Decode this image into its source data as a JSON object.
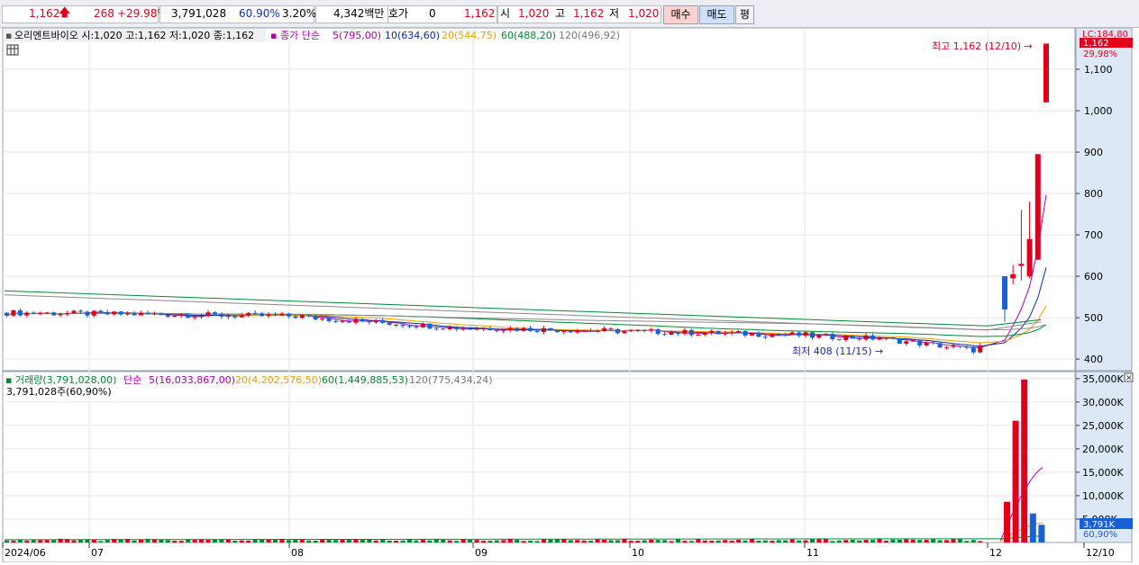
{
  "quote_bar": {
    "price": "1,162",
    "change_arrow": "up-arrow-icon",
    "change": "268",
    "change_pct": "+29.98%",
    "volume": "3,791,028",
    "volume_ratio": "60.90%",
    "turnover": "3.20%",
    "amount": "4,342백만",
    "hoga_label": "호가",
    "hoga_value": "0",
    "hoga_price": "1,162",
    "open_label": "시",
    "open_value": "1,020",
    "high_label": "고",
    "high_value": "1,162",
    "low_label": "저",
    "low_value": "1,020",
    "buy_label": "매수",
    "sell_label": "매도",
    "avg_label": "평"
  },
  "price_panel": {
    "stock_info": "오리엔트바이오 시:1,020 고:1,162 저:1,020 종:1,162",
    "ma_label": "종가 단순",
    "ma5": "5(795,00)",
    "ma10": "10(634,60)",
    "ma20": "20(544,75)",
    "ma60": "60(488,20)",
    "ma120": "120(496,92)",
    "lc_label": "LC:184,80",
    "price_tag": "1,162",
    "pct_tag": "29,98%",
    "high_note": "최고 1,162 (12/10) →",
    "low_note": "최저 408 (11/15) →"
  },
  "volume_panel": {
    "label": "거래량(3,791,028,00)",
    "ma_label": "단순",
    "ma5": "5(16,033,867,00)",
    "ma20": "20(4,202,576,50)",
    "ma60": "60(1,449,885,53)",
    "ma120": "120(775,434,24)",
    "current": "3,791,028주(60,90%)",
    "vol_tag": "3,791K",
    "pct_tag": "60,90%"
  },
  "colors": {
    "up": "#e0001c",
    "down": "#1760d6",
    "ma5": "#b000b0",
    "ma10": "#0a2a9c",
    "ma20": "#f0a000",
    "ma60": "#008a30",
    "ma120": "#8a8a8a",
    "axis_bg": "#dce8f5"
  },
  "chart_data": {
    "type": "candlestick",
    "x_labels": [
      "2024/06",
      "07",
      "08",
      "09",
      "10",
      "11",
      "12",
      "12/10"
    ],
    "price_ticks": [
      400,
      500,
      600,
      700,
      800,
      900,
      "1,000",
      "1,100"
    ],
    "volume_ticks": [
      "5,000K",
      "10,000K",
      "15,000K",
      "20,000K",
      "25,000K",
      "30,000K",
      "35,000K"
    ],
    "ylim_price": [
      372,
      1200
    ],
    "ylim_volume": [
      0,
      36500000
    ],
    "last_days": [
      {
        "open": 600,
        "close": 520,
        "high": 600,
        "low": 490
      },
      {
        "open": 595,
        "close": 605,
        "high": 627,
        "low": 580
      },
      {
        "open": 625,
        "close": 630,
        "high": 760,
        "low": 590
      },
      {
        "open": 600,
        "close": 690,
        "high": 780,
        "low": 595
      },
      {
        "open": 640,
        "close": 895,
        "high": 895,
        "low": 640
      },
      {
        "open": 1020,
        "close": 1162,
        "high": 1162,
        "low": 1020
      }
    ],
    "last_volumes": [
      8700000,
      26000000,
      34800000,
      6200000,
      3791028
    ],
    "ma_values": {
      "ma5": 795.0,
      "ma10": 634.6,
      "ma20": 544.75,
      "ma60": 488.2,
      "ma120": 496.92
    }
  }
}
